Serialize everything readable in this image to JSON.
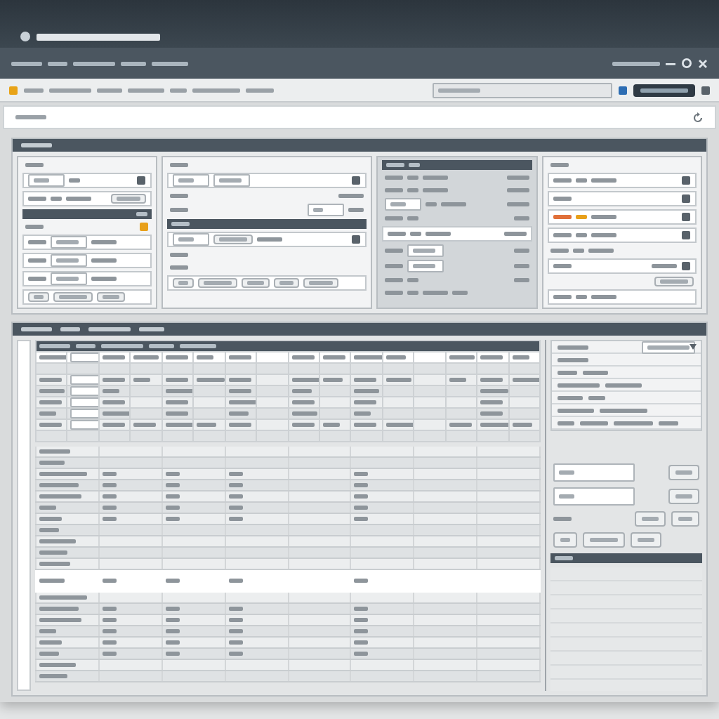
{
  "title_bar": {
    "items": [
      {
        "kind": "logo"
      },
      {
        "kind": "title"
      }
    ]
  },
  "menu_bar": {
    "items": [
      {
        "kind": "line"
      },
      {
        "kind": "line"
      },
      {
        "kind": "line"
      },
      {
        "kind": "line"
      },
      {
        "kind": "line"
      },
      {
        "kind": "spacer"
      },
      {
        "kind": "line"
      },
      {
        "kind": "minimize"
      },
      {
        "kind": "settings"
      },
      {
        "kind": "close"
      }
    ]
  },
  "toolbar": {
    "items": [
      {
        "kind": "icon",
        "color": "#e8a317"
      },
      {
        "kind": "line"
      },
      {
        "kind": "line"
      },
      {
        "kind": "line"
      },
      {
        "kind": "line"
      },
      {
        "kind": "line"
      },
      {
        "kind": "line"
      },
      {
        "kind": "line"
      },
      {
        "kind": "spacer"
      },
      {
        "kind": "field"
      },
      {
        "kind": "icon",
        "color": "#2d6db3"
      },
      {
        "kind": "button"
      },
      {
        "kind": "icon",
        "color": "#59626a"
      }
    ]
  },
  "address_bar": {
    "items": [
      {
        "kind": "line"
      },
      {
        "kind": "spacer"
      },
      {
        "kind": "refresh"
      }
    ]
  },
  "top_section": {
    "header": [
      {
        "kind": "line"
      }
    ],
    "cards": [
      {
        "kind": "light",
        "rows": [
          {
            "kind": "plain",
            "items": [
              {
                "kind": "line"
              }
            ]
          },
          {
            "kind": "boxed",
            "items": [
              {
                "kind": "field"
              },
              {
                "kind": "line"
              },
              {
                "kind": "spacer"
              },
              {
                "kind": "icon",
                "color": "#59626a"
              }
            ]
          },
          {
            "kind": "boxed",
            "items": [
              {
                "kind": "line"
              },
              {
                "kind": "line"
              },
              {
                "kind": "line"
              },
              {
                "kind": "spacer"
              },
              {
                "kind": "button"
              }
            ]
          },
          {
            "kind": "bar",
            "items": [
              {
                "kind": "spacer"
              },
              {
                "kind": "line"
              }
            ]
          },
          {
            "kind": "plain",
            "items": [
              {
                "kind": "line"
              },
              {
                "kind": "spacer"
              },
              {
                "kind": "icon",
                "color": "#e8a01a"
              }
            ]
          },
          {
            "kind": "boxed",
            "items": [
              {
                "kind": "line"
              },
              {
                "kind": "field"
              },
              {
                "kind": "line"
              }
            ]
          },
          {
            "kind": "boxed",
            "items": [
              {
                "kind": "line"
              },
              {
                "kind": "field"
              },
              {
                "kind": "line"
              }
            ]
          },
          {
            "kind": "boxed",
            "items": [
              {
                "kind": "line"
              },
              {
                "kind": "field"
              },
              {
                "kind": "line"
              }
            ]
          },
          {
            "kind": "boxed",
            "items": [
              {
                "kind": "button"
              },
              {
                "kind": "button"
              },
              {
                "kind": "button"
              }
            ]
          }
        ]
      },
      {
        "kind": "light",
        "rows": [
          {
            "kind": "plain",
            "items": [
              {
                "kind": "line"
              }
            ]
          },
          {
            "kind": "boxed",
            "items": [
              {
                "kind": "field"
              },
              {
                "kind": "field"
              },
              {
                "kind": "spacer"
              },
              {
                "kind": "icon",
                "color": "#59626a"
              }
            ]
          },
          {
            "kind": "plain",
            "items": [
              {
                "kind": "line"
              },
              {
                "kind": "spacer"
              },
              {
                "kind": "line"
              }
            ]
          },
          {
            "kind": "plain",
            "items": [
              {
                "kind": "line"
              },
              {
                "kind": "spacer"
              },
              {
                "kind": "field"
              },
              {
                "kind": "line"
              }
            ]
          },
          {
            "kind": "bar",
            "items": [
              {
                "kind": "line"
              }
            ]
          },
          {
            "kind": "boxed",
            "items": [
              {
                "kind": "field"
              },
              {
                "kind": "button"
              },
              {
                "kind": "line"
              },
              {
                "kind": "spacer"
              },
              {
                "kind": "icon",
                "color": "#59626a"
              }
            ]
          },
          {
            "kind": "plain",
            "items": [
              {
                "kind": "line"
              }
            ]
          },
          {
            "kind": "plain",
            "items": [
              {
                "kind": "line"
              }
            ]
          },
          {
            "kind": "boxed",
            "items": [
              {
                "kind": "button"
              },
              {
                "kind": "button"
              },
              {
                "kind": "button"
              },
              {
                "kind": "button"
              },
              {
                "kind": "button"
              }
            ]
          }
        ]
      },
      {
        "kind": "shaded",
        "rows": [
          {
            "kind": "bar",
            "items": [
              {
                "kind": "line"
              },
              {
                "kind": "line"
              }
            ]
          },
          {
            "kind": "plain",
            "items": [
              {
                "kind": "line"
              },
              {
                "kind": "line"
              },
              {
                "kind": "line"
              },
              {
                "kind": "spacer"
              },
              {
                "kind": "line"
              }
            ]
          },
          {
            "kind": "plain",
            "items": [
              {
                "kind": "line"
              },
              {
                "kind": "line"
              },
              {
                "kind": "line"
              },
              {
                "kind": "spacer"
              },
              {
                "kind": "line"
              }
            ]
          },
          {
            "kind": "plain",
            "items": [
              {
                "kind": "field"
              },
              {
                "kind": "line"
              },
              {
                "kind": "line"
              },
              {
                "kind": "spacer"
              },
              {
                "kind": "line"
              }
            ]
          },
          {
            "kind": "plain",
            "items": [
              {
                "kind": "line"
              },
              {
                "kind": "line"
              },
              {
                "kind": "spacer"
              },
              {
                "kind": "line"
              }
            ]
          },
          {
            "kind": "boxed",
            "items": [
              {
                "kind": "line"
              },
              {
                "kind": "line"
              },
              {
                "kind": "line"
              },
              {
                "kind": "spacer"
              },
              {
                "kind": "line"
              }
            ]
          },
          {
            "kind": "plain",
            "items": [
              {
                "kind": "line"
              },
              {
                "kind": "field"
              },
              {
                "kind": "spacer"
              },
              {
                "kind": "line"
              }
            ]
          },
          {
            "kind": "plain",
            "items": [
              {
                "kind": "line"
              },
              {
                "kind": "field"
              },
              {
                "kind": "spacer"
              },
              {
                "kind": "line"
              }
            ]
          },
          {
            "kind": "plain",
            "items": [
              {
                "kind": "line"
              },
              {
                "kind": "line"
              },
              {
                "kind": "spacer"
              },
              {
                "kind": "line"
              }
            ]
          },
          {
            "kind": "plain",
            "items": [
              {
                "kind": "line"
              },
              {
                "kind": "line"
              },
              {
                "kind": "line"
              },
              {
                "kind": "line"
              }
            ]
          }
        ]
      },
      {
        "kind": "light",
        "rows": [
          {
            "kind": "plain",
            "items": [
              {
                "kind": "line"
              }
            ]
          },
          {
            "kind": "boxed",
            "items": [
              {
                "kind": "line"
              },
              {
                "kind": "line"
              },
              {
                "kind": "line"
              },
              {
                "kind": "spacer"
              },
              {
                "kind": "icon",
                "color": "#59626a"
              }
            ]
          },
          {
            "kind": "boxed",
            "items": [
              {
                "kind": "line"
              },
              {
                "kind": "spacer"
              },
              {
                "kind": "icon",
                "color": "#59626a"
              }
            ]
          },
          {
            "kind": "boxed",
            "items": [
              {
                "kind": "line",
                "color": "#e0703a"
              },
              {
                "kind": "line",
                "color": "#e8a01a"
              },
              {
                "kind": "line"
              },
              {
                "kind": "spacer"
              },
              {
                "kind": "icon",
                "color": "#59626a"
              }
            ]
          },
          {
            "kind": "boxed",
            "items": [
              {
                "kind": "line"
              },
              {
                "kind": "line"
              },
              {
                "kind": "line"
              },
              {
                "kind": "spacer"
              },
              {
                "kind": "icon",
                "color": "#59626a"
              }
            ]
          },
          {
            "kind": "plain",
            "items": [
              {
                "kind": "line"
              },
              {
                "kind": "line"
              },
              {
                "kind": "line"
              }
            ]
          },
          {
            "kind": "boxed",
            "items": [
              {
                "kind": "line"
              },
              {
                "kind": "spacer"
              },
              {
                "kind": "line"
              },
              {
                "kind": "icon",
                "color": "#59626a"
              }
            ]
          },
          {
            "kind": "plain",
            "items": [
              {
                "kind": "spacer"
              },
              {
                "kind": "button"
              }
            ]
          },
          {
            "kind": "boxed",
            "items": [
              {
                "kind": "line"
              },
              {
                "kind": "line"
              },
              {
                "kind": "line"
              }
            ]
          }
        ]
      }
    ]
  },
  "main_section": {
    "header": [
      {
        "kind": "line"
      },
      {
        "kind": "line"
      },
      {
        "kind": "line"
      },
      {
        "kind": "line"
      }
    ],
    "table": {
      "header": [
        {
          "kind": "line"
        },
        {
          "kind": "line"
        },
        {
          "kind": "line"
        },
        {
          "kind": "line"
        },
        {
          "kind": "line"
        }
      ],
      "columns": [
        {
          "kind": "label"
        },
        {
          "kind": "field"
        },
        {
          "kind": "line"
        },
        {
          "kind": "line"
        },
        {
          "kind": "line"
        },
        {
          "kind": "line"
        },
        {
          "kind": "line"
        },
        {
          "kind": "blank"
        },
        {
          "kind": "line"
        },
        {
          "kind": "line"
        },
        {
          "kind": "line"
        },
        {
          "kind": "line"
        },
        {
          "kind": "blank"
        },
        {
          "kind": "line"
        },
        {
          "kind": "line"
        },
        {
          "kind": "line"
        }
      ],
      "rows": [
        {
          "kind": "heading",
          "selected": false
        },
        {
          "kind": "blank",
          "selected": false
        },
        {
          "kind": "full",
          "selected": false
        },
        {
          "kind": "sparse",
          "selected": false
        },
        {
          "kind": "sparse",
          "selected": false
        },
        {
          "kind": "sparse",
          "selected": false
        },
        {
          "kind": "full",
          "selected": false
        },
        {
          "kind": "blank",
          "selected": false
        }
      ]
    },
    "lower_table": {
      "columns": [
        {
          "kind": "label"
        },
        {
          "kind": "line"
        },
        {
          "kind": "line"
        },
        {
          "kind": "line"
        },
        {
          "kind": "blank"
        },
        {
          "kind": "line"
        },
        {
          "kind": "blank"
        },
        {
          "kind": "blank"
        }
      ],
      "rows": [
        {
          "kind": "label",
          "selected": false
        },
        {
          "kind": "label",
          "selected": false
        },
        {
          "kind": "full",
          "selected": false
        },
        {
          "kind": "full",
          "selected": false
        },
        {
          "kind": "full",
          "selected": false
        },
        {
          "kind": "full",
          "selected": false
        },
        {
          "kind": "full",
          "selected": false
        },
        {
          "kind": "label",
          "selected": false
        },
        {
          "kind": "label",
          "selected": false
        },
        {
          "kind": "label",
          "selected": false
        },
        {
          "kind": "label",
          "selected": false
        },
        {
          "kind": "full",
          "selected": true
        },
        {
          "kind": "label",
          "selected": false
        },
        {
          "kind": "full",
          "selected": false
        },
        {
          "kind": "full",
          "selected": false
        },
        {
          "kind": "full",
          "selected": false
        },
        {
          "kind": "full",
          "selected": false
        },
        {
          "kind": "full",
          "selected": false
        },
        {
          "kind": "label",
          "selected": false
        },
        {
          "kind": "label",
          "selected": false
        }
      ]
    },
    "side": {
      "list_header": [
        {
          "kind": "line"
        },
        {
          "kind": "spacer"
        },
        {
          "kind": "dropdown"
        }
      ],
      "list": [
        {
          "kind": "line"
        },
        {
          "kind": "pair"
        },
        {
          "kind": "pair"
        },
        {
          "kind": "pair"
        },
        {
          "kind": "pair"
        },
        {
          "kind": "quad"
        }
      ],
      "form": [
        {
          "kind": "plain",
          "items": [
            {
              "kind": "field"
            },
            {
              "kind": "spacer"
            },
            {
              "kind": "button"
            }
          ]
        },
        {
          "kind": "plain",
          "items": [
            {
              "kind": "field"
            },
            {
              "kind": "spacer"
            },
            {
              "kind": "button"
            }
          ]
        },
        {
          "kind": "plain",
          "items": [
            {
              "kind": "line"
            },
            {
              "kind": "spacer"
            },
            {
              "kind": "button"
            },
            {
              "kind": "button"
            }
          ]
        },
        {
          "kind": "plain",
          "items": [
            {
              "kind": "button"
            },
            {
              "kind": "button"
            },
            {
              "kind": "button"
            }
          ]
        },
        {
          "kind": "bar",
          "items": [
            {
              "kind": "line"
            }
          ]
        }
      ]
    }
  }
}
